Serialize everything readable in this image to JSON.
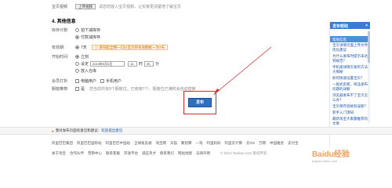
{
  "top_row": {
    "label": "宝贝视频",
    "btn_label": "上传视频",
    "hint": "请您您放入宝贝视频，让买家更清楚地了解宝贝"
  },
  "section": {
    "title": "4. 其他信息"
  },
  "invoice": {
    "label": "库存计数:",
    "options": [
      "拍下减库存",
      "付款减库存"
    ]
  },
  "warranty": {
    "label": "有效期:",
    "options": [
      "7天"
    ],
    "notice": "即日起全网一口价宝贝的有效期统一为7天"
  },
  "start_time": {
    "label": "开始时间:",
    "opt_now": "立刻",
    "opt_set": "设定",
    "date": "2014年9月4日",
    "hour": "14",
    "minute": "05",
    "opt_warehouse": "放入仓库"
  },
  "member": {
    "label": "会员打折:",
    "options": [
      "电脑用户",
      "手机用户"
    ]
  },
  "recommend": {
    "label": "橱窗推荐:",
    "opt": "是",
    "hint": "您当前共有8个橱窗位，已使用7个，橱窗位已满时会自动替换"
  },
  "publish": {
    "label": "发布"
  },
  "sidebar": {
    "header": "发布帮助",
    "close": "×",
    "subheader": "帮助信息",
    "items": [
      "宝贝详情页面上传文件优化建议",
      "为什么发布时提示未达到规范？",
      "手机类详情页发布方法大揭秘",
      "如何快速设置宝贝？",
      "一般式卖家，商品发布问题的详解",
      "浏览器发布不了宝贝怎么办？",
      "宝贝保存退格有误呢？",
      "新手入门须知",
      "最新淘宝大家都推荐的文章"
    ]
  },
  "strip": {
    "prefix": "我对发布页面有意见和建议：",
    "link": "欢迎提出意见"
  },
  "footer": {
    "row1": [
      "阿里巴巴集团",
      "阿里巴巴国际站",
      "阿里巴巴中国站",
      "全球速卖通",
      "淘宝网",
      "天猫",
      "聚划算",
      "一淘",
      "阿里妈妈",
      "阿里云计算",
      "云OS",
      "万网",
      "中国雅虎",
      "支付宝"
    ],
    "row2": [
      "关于淘宝",
      "合作伙伴",
      "营销中心",
      "联系客服",
      "开放平台",
      "诚征英才",
      "联系我们",
      "网站地图",
      "法律声明"
    ],
    "copyright": "© 2014 Taobao.com 版权所有",
    "watermark": "Baidu经验",
    "watermark_url": "jingyan.baidu.com"
  }
}
